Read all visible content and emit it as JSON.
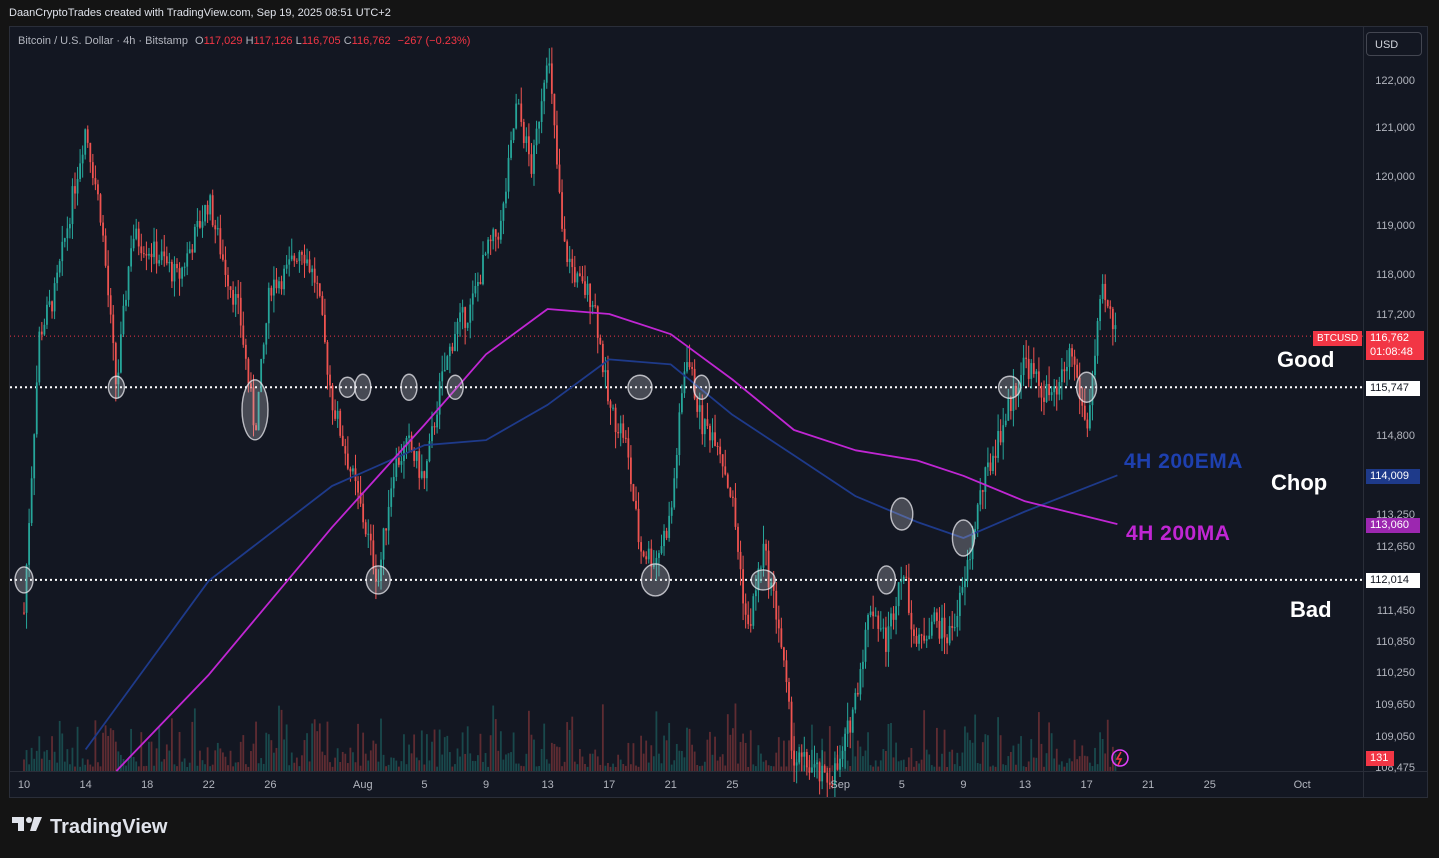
{
  "header": {
    "attribution": "DaanCryptoTrades created with TradingView.com, Sep 19, 2025 08:51 UTC+2"
  },
  "legend": {
    "symbol": "Bitcoin / U.S. Dollar · 4h · Bitstamp",
    "o_label": "O",
    "o": "117,029",
    "h_label": "H",
    "h": "117,126",
    "l_label": "L",
    "l": "116,705",
    "c_label": "C",
    "c": "116,762",
    "change": "−267 (−0.23%)"
  },
  "currency_button": "USD",
  "colors": {
    "up": "#26a69a",
    "down": "#ef5350",
    "ema": "#1e3a8a",
    "ma": "#c026d3",
    "background": "#131722"
  },
  "annotations": {
    "zone_good": "Good",
    "zone_chop": "Chop",
    "zone_bad": "Bad",
    "ema_label": "4H 200EMA",
    "ma_label": "4H 200MA"
  },
  "price_tags": {
    "symbol_tag": "BTCUSD",
    "last_price": "116,762",
    "countdown": "01:08:48",
    "level_upper": "115,747",
    "ema_value": "114,009",
    "ma_value": "113,060",
    "level_lower": "112,014",
    "volume": "131"
  },
  "footer": {
    "brand": "TradingView"
  },
  "chart_data": {
    "type": "line",
    "title": "Bitcoin / U.S. Dollar · 4h · Bitstamp",
    "y_axis": {
      "ticks": [
        122000,
        121000,
        120000,
        119000,
        118000,
        117200,
        114800,
        113250,
        112650,
        111450,
        110850,
        110250,
        109650,
        109050,
        108475
      ],
      "tick_labels": [
        "122,000",
        "121,000",
        "120,000",
        "119,000",
        "118,000",
        "117,200",
        "114,800",
        "113,250",
        "112,650",
        "111,450",
        "110,850",
        "110,250",
        "109,650",
        "109,050",
        "108,475"
      ],
      "scale": "non-linear (compressed lower band)",
      "ylim": [
        108400,
        122800
      ]
    },
    "x_axis": {
      "tick_labels": [
        "10",
        "14",
        "18",
        "22",
        "26",
        "Aug",
        "5",
        "9",
        "13",
        "17",
        "21",
        "25",
        "Sep",
        "5",
        "9",
        "13",
        "17",
        "21",
        "25",
        "Oct"
      ],
      "xlim": [
        "Jul 10",
        "Oct 1"
      ]
    },
    "horizontal_levels": [
      {
        "label": "115,747",
        "value": 115747
      },
      {
        "label": "112,014",
        "value": 112014
      }
    ],
    "series": [
      {
        "name": "BTCUSD",
        "x": [
          "Jul 10",
          "Jul 11",
          "Jul 12",
          "Jul 14",
          "Jul 15",
          "Jul 16",
          "Jul 17",
          "Jul 19",
          "Jul 20",
          "Jul 22",
          "Jul 23",
          "Jul 24",
          "Jul 25",
          "Jul 26",
          "Jul 27",
          "Jul 28",
          "Jul 29",
          "Jul 30",
          "Aug 1",
          "Aug 2",
          "Aug 3",
          "Aug 4",
          "Aug 5",
          "Aug 6",
          "Aug 7",
          "Aug 8",
          "Aug 9",
          "Aug 10",
          "Aug 11",
          "Aug 12",
          "Aug 13",
          "Aug 14",
          "Aug 15",
          "Aug 16",
          "Aug 17",
          "Aug 18",
          "Aug 19",
          "Aug 20",
          "Aug 21",
          "Aug 22",
          "Aug 23",
          "Aug 24",
          "Aug 25",
          "Aug 26",
          "Aug 27",
          "Aug 28",
          "Aug 29",
          "Aug 30",
          "Aug 31",
          "Sep 1",
          "Sep 2",
          "Sep 3",
          "Sep 4",
          "Sep 5",
          "Sep 6",
          "Sep 7",
          "Sep 8",
          "Sep 9",
          "Sep 10",
          "Sep 11",
          "Sep 12",
          "Sep 13",
          "Sep 14",
          "Sep 15",
          "Sep 16",
          "Sep 17",
          "Sep 18",
          "Sep 19"
        ],
        "values": [
          111400,
          116800,
          117600,
          121000,
          119200,
          115700,
          118800,
          118300,
          117900,
          119500,
          118200,
          117200,
          114900,
          117800,
          118000,
          118600,
          117800,
          115500,
          113200,
          112000,
          114200,
          114600,
          113900,
          115700,
          116900,
          117300,
          118400,
          119000,
          121500,
          120100,
          122700,
          118600,
          117800,
          117500,
          115300,
          114800,
          112600,
          112400,
          113200,
          116500,
          115000,
          114800,
          113500,
          111000,
          112600,
          111200,
          108600,
          108500,
          108200,
          108500,
          109800,
          111600,
          110800,
          112300,
          110700,
          111300,
          110900,
          111800,
          113500,
          114500,
          115400,
          116300,
          115700,
          115500,
          116500,
          114900,
          117600,
          116762
        ]
      },
      {
        "name": "4H 200EMA",
        "x": [
          "Jul 14",
          "Jul 22",
          "Jul 30",
          "Aug 5",
          "Aug 9",
          "Aug 13",
          "Aug 17",
          "Aug 21",
          "Aug 25",
          "Aug 29",
          "Sep 2",
          "Sep 6",
          "Sep 9",
          "Sep 13",
          "Sep 19"
        ],
        "values": [
          108800,
          112000,
          113800,
          114600,
          114700,
          115400,
          116300,
          116200,
          115200,
          114400,
          113600,
          113100,
          112800,
          113300,
          114009
        ]
      },
      {
        "name": "4H 200MA",
        "x": [
          "Jul 16",
          "Jul 22",
          "Jul 30",
          "Aug 5",
          "Aug 9",
          "Aug 13",
          "Aug 17",
          "Aug 21",
          "Aug 25",
          "Aug 29",
          "Sep 2",
          "Sep 6",
          "Sep 9",
          "Sep 13",
          "Sep 19"
        ],
        "values": [
          108400,
          110200,
          113000,
          115000,
          116400,
          117300,
          117200,
          116800,
          115900,
          114900,
          114500,
          114300,
          114000,
          113500,
          113060
        ]
      }
    ]
  }
}
